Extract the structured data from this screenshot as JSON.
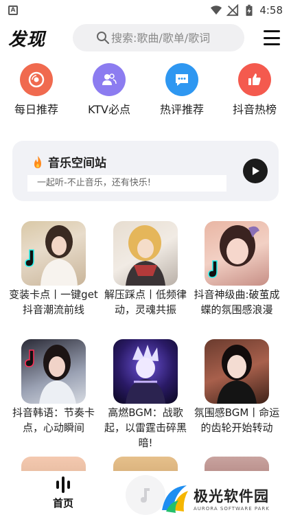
{
  "status_bar": {
    "time": "4:58",
    "app_icon_letter": "A"
  },
  "header": {
    "title": "发现",
    "search_placeholder": "搜索:歌曲/歌单/歌词"
  },
  "quick_entries": [
    {
      "label": "每日推荐",
      "icon": "vinyl-icon",
      "color": "#f06a4f"
    },
    {
      "label": "KTV必点",
      "icon": "users-icon",
      "color": "#8c7cf0"
    },
    {
      "label": "热评推荐",
      "icon": "comment-icon",
      "color": "#2e97f1"
    },
    {
      "label": "抖音热榜",
      "icon": "thumbs-up-icon",
      "color": "#f45a4e"
    }
  ],
  "banner": {
    "title": "音乐空间站",
    "subtitle": "一起听-不止音乐，还有快乐!"
  },
  "playlists": [
    {
      "title": "变装卡点丨一键get抖音潮流前线"
    },
    {
      "title": "解压踩点丨低频律动，灵魂共振"
    },
    {
      "title": "抖音神级曲:破茧成蝶的氛围感浪漫"
    },
    {
      "title": "抖音韩语：节奏卡点，心动瞬间"
    },
    {
      "title": "高燃BGM：战歌起，以雷霆击碎黑暗!"
    },
    {
      "title": "氛围感BGM丨命运的齿轮开始转动"
    }
  ],
  "bottom_nav": {
    "home_label": "首页"
  },
  "watermark": {
    "title": "极光软件园",
    "subtitle": "AURORA SOFTWARE PARK"
  }
}
